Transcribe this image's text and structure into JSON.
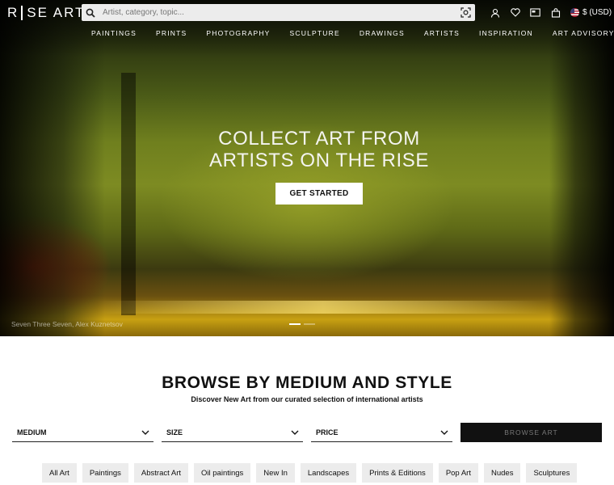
{
  "header": {
    "logo_left": "R",
    "logo_right": "SE ART",
    "search": {
      "placeholder": "Artist, category, topic..."
    },
    "currency": "$ (USD)"
  },
  "nav": {
    "items": [
      "PAINTINGS",
      "PRINTS",
      "PHOTOGRAPHY",
      "SCULPTURE",
      "DRAWINGS",
      "ARTISTS",
      "INSPIRATION",
      "ART ADVISORY"
    ]
  },
  "hero": {
    "title_line1": "COLLECT ART FROM",
    "title_line2": "ARTISTS ON THE RISE",
    "cta": "GET STARTED",
    "caption": "Seven Three Seven, Alex Kuznetsov",
    "slide_count": 2,
    "active_slide": 1
  },
  "browse": {
    "title": "BROWSE BY MEDIUM AND STYLE",
    "subtitle": "Discover New Art from our curated selection of international artists",
    "select_medium": "MEDIUM",
    "select_size": "SIZE",
    "select_price": "PRICE",
    "button": "BROWSE ART",
    "tags": [
      "All Art",
      "Paintings",
      "Abstract Art",
      "Oil paintings",
      "New In",
      "Landscapes",
      "Prints & Editions",
      "Pop Art",
      "Nudes",
      "Sculptures"
    ]
  },
  "icons": {
    "search": "search-icon",
    "camera": "visual-search-icon",
    "account": "user-icon",
    "wishlist": "heart-icon",
    "gift": "gift-card-icon",
    "cart": "cart-icon",
    "flag": "us-flag-icon",
    "chevron": "chevron-down-icon"
  }
}
